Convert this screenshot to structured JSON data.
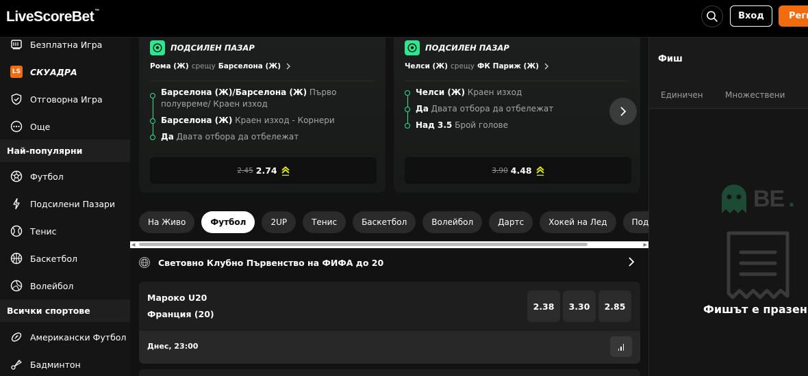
{
  "header": {
    "logo_main": "LiveScore",
    "logo_accent": "Bet",
    "logo_tm": "™",
    "login_label": "Вход",
    "register_label": "Регистрация"
  },
  "sidebar": {
    "items_top": [
      {
        "label": "Безплатна Игра",
        "icon": "free-game-icon"
      },
      {
        "label": "СКУАДРА",
        "icon": "ls-badge",
        "badge": "LS"
      },
      {
        "label": "Отговорна Игра",
        "icon": "shield-check-icon"
      },
      {
        "label": "Още",
        "icon": "more-icon"
      }
    ],
    "popular_heading": "Най-популярни",
    "popular": [
      {
        "label": "Футбол",
        "icon": "football-icon"
      },
      {
        "label": "Подсилени Пазари",
        "icon": "boost-icon"
      },
      {
        "label": "Тенис",
        "icon": "tennis-icon"
      },
      {
        "label": "Баскетбол",
        "icon": "basketball-icon"
      },
      {
        "label": "Волейбол",
        "icon": "volleyball-icon"
      }
    ],
    "all_heading": "Всички спортове",
    "all": [
      {
        "label": "Американски Футбол",
        "icon": "american-football-icon"
      },
      {
        "label": "Бадминтон",
        "icon": "badminton-icon"
      }
    ]
  },
  "bet_builders": [
    {
      "badge": "ПОДСИЛЕН ПАЗАР",
      "home": "Рома (Ж)",
      "vs": "срещу",
      "away": "Барселона (Ж)",
      "legs": [
        {
          "bold": "Барселона (Ж)/Барселона (Ж)",
          "text": " Първо полувреме/ Краен изход"
        },
        {
          "bold": "Барселона (Ж)",
          "text": " Краен изход - Корнери"
        },
        {
          "bold": "Да",
          "text": " Двата отбора да отбележат"
        }
      ],
      "old_odds": "2.45",
      "new_odds": "2.74"
    },
    {
      "badge": "ПОДСИЛЕН ПАЗАР",
      "home": "Челси (Ж)",
      "vs": "срещу",
      "away": "ФК Париж (Ж)",
      "legs": [
        {
          "bold": "Челси (Ж)",
          "text": " Краен изход"
        },
        {
          "bold": "Да",
          "text": " Двата отбора да отбележат"
        },
        {
          "bold": "Над 3.5",
          "text": " Брой голове"
        }
      ],
      "old_odds": "3.90",
      "new_odds": "4.48"
    }
  ],
  "sport_chips": [
    "На Живо",
    "Футбол",
    "2UP",
    "Тенис",
    "Баскетбол",
    "Волейбол",
    "Дартс",
    "Хокей на Лед",
    "Подсилени Пазари"
  ],
  "active_chip": "Футбол",
  "competition": {
    "title": "Световно Клубно Първенство на ФИФА до 20"
  },
  "match": {
    "home": "Мароко U20",
    "away": "Франция (20)",
    "odds": [
      "2.38",
      "3.30",
      "2.85"
    ],
    "time": "Днес, 23:00"
  },
  "betslip": {
    "title": "Фиш",
    "tab_single": "Единичен",
    "tab_multi": "Множествени",
    "logo_text": "BE",
    "empty_text": "Фишът е празен"
  },
  "colors": {
    "accent_orange": "#f26b0f",
    "accent_green": "#2ee68f",
    "boost_yellow": "#d7e61c"
  }
}
